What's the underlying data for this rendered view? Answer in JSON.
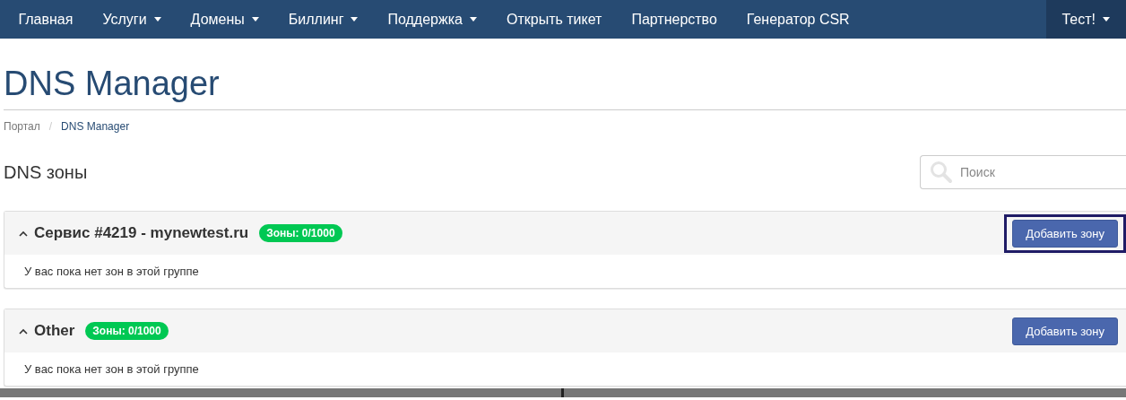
{
  "nav": {
    "items": [
      {
        "label": "Главная",
        "dropdown": false
      },
      {
        "label": "Услуги",
        "dropdown": true
      },
      {
        "label": "Домены",
        "dropdown": true
      },
      {
        "label": "Биллинг",
        "dropdown": true
      },
      {
        "label": "Поддержка",
        "dropdown": true
      },
      {
        "label": "Открыть тикет",
        "dropdown": false
      },
      {
        "label": "Партнерство",
        "dropdown": false
      },
      {
        "label": "Генератор CSR",
        "dropdown": false
      }
    ],
    "user": {
      "label": "Тест!",
      "dropdown": true
    }
  },
  "page_title": "DNS Manager",
  "breadcrumb_separator": "/",
  "breadcrumb": [
    {
      "label": "Портал",
      "current": false
    },
    {
      "label": "DNS Manager",
      "current": true
    }
  ],
  "section_title": "DNS зоны",
  "search": {
    "placeholder": "Поиск"
  },
  "groups": [
    {
      "title": "Сервис #4219 - mynewtest.ru",
      "badge": "Зоны: 0/1000",
      "button": "Добавить зону",
      "highlighted": true,
      "empty_text": "У вас пока нет зон в этой группе"
    },
    {
      "title": "Other",
      "badge": "Зоны: 0/1000",
      "button": "Добавить зону",
      "highlighted": false,
      "empty_text": "У вас пока нет зон в этой группе"
    }
  ]
}
